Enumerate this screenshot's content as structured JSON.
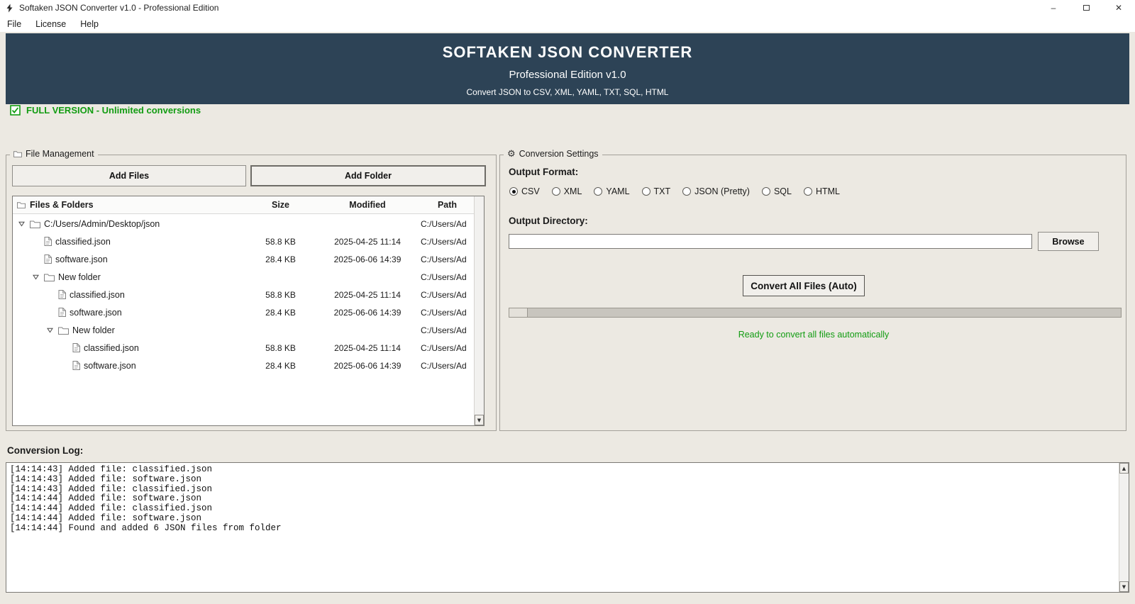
{
  "window": {
    "title": "Softaken JSON Converter v1.0 - Professional Edition"
  },
  "menu": {
    "items": [
      "File",
      "License",
      "Help"
    ]
  },
  "header": {
    "title": "SOFTAKEN JSON CONVERTER",
    "subtitle": "Professional Edition v1.0",
    "tagline": "Convert JSON to CSV, XML, YAML, TXT, SQL, HTML"
  },
  "license_banner": {
    "text": "FULL VERSION - Unlimited conversions"
  },
  "file_management": {
    "group_label": "File Management",
    "add_files_label": "Add Files",
    "add_folder_label": "Add Folder",
    "table": {
      "headers": [
        "Files & Folders",
        "Size",
        "Modified",
        "Path"
      ],
      "rows": [
        {
          "name": "C:/Users/Admin/Desktop/json",
          "type": "folder",
          "expanded": true,
          "level": 0,
          "size": "",
          "modified": "",
          "path": "C:/Users/Ad"
        },
        {
          "name": "classified.json",
          "type": "file",
          "level": 1,
          "size": "58.8 KB",
          "modified": "2025-04-25 11:14",
          "path": "C:/Users/Ad"
        },
        {
          "name": "software.json",
          "type": "file",
          "level": 1,
          "size": "28.4 KB",
          "modified": "2025-06-06 14:39",
          "path": "C:/Users/Ad"
        },
        {
          "name": "New folder",
          "type": "folder",
          "expanded": true,
          "level": 1,
          "size": "",
          "modified": "",
          "path": "C:/Users/Ad"
        },
        {
          "name": "classified.json",
          "type": "file",
          "level": 2,
          "size": "58.8 KB",
          "modified": "2025-04-25 11:14",
          "path": "C:/Users/Ad"
        },
        {
          "name": "software.json",
          "type": "file",
          "level": 2,
          "size": "28.4 KB",
          "modified": "2025-06-06 14:39",
          "path": "C:/Users/Ad"
        },
        {
          "name": "New folder",
          "type": "folder",
          "expanded": true,
          "level": 2,
          "size": "",
          "modified": "",
          "path": "C:/Users/Ad"
        },
        {
          "name": "classified.json",
          "type": "file",
          "level": 3,
          "size": "58.8 KB",
          "modified": "2025-04-25 11:14",
          "path": "C:/Users/Ad"
        },
        {
          "name": "software.json",
          "type": "file",
          "level": 3,
          "size": "28.4 KB",
          "modified": "2025-06-06 14:39",
          "path": "C:/Users/Ad"
        }
      ]
    }
  },
  "conversion_settings": {
    "group_label": "Conversion Settings",
    "output_format_label": "Output Format:",
    "formats": [
      {
        "label": "CSV",
        "selected": true
      },
      {
        "label": "XML",
        "selected": false
      },
      {
        "label": "YAML",
        "selected": false
      },
      {
        "label": "TXT",
        "selected": false
      },
      {
        "label": "JSON (Pretty)",
        "selected": false
      },
      {
        "label": "SQL",
        "selected": false
      },
      {
        "label": "HTML",
        "selected": false
      }
    ],
    "output_directory_label": "Output Directory:",
    "output_directory_value": "",
    "browse_label": "Browse",
    "convert_button_label": "Convert All Files (Auto)",
    "progress_percent": 3,
    "status_text": "Ready to convert all files automatically"
  },
  "conversion_log": {
    "label": "Conversion Log:",
    "lines": [
      "[14:14:43] Added file: classified.json",
      "[14:14:43] Added file: software.json",
      "[14:14:43] Added file: classified.json",
      "[14:14:44] Added file: software.json",
      "[14:14:44] Added file: classified.json",
      "[14:14:44] Added file: software.json",
      "[14:14:44] Found and added 6 JSON files from folder"
    ]
  },
  "icons": {
    "minimize": "–",
    "close": "✕",
    "gear": "⚙",
    "arrow_up": "▲",
    "arrow_down": "▼"
  },
  "colors": {
    "header_bg": "#2d4356",
    "success_green": "#129c12"
  }
}
